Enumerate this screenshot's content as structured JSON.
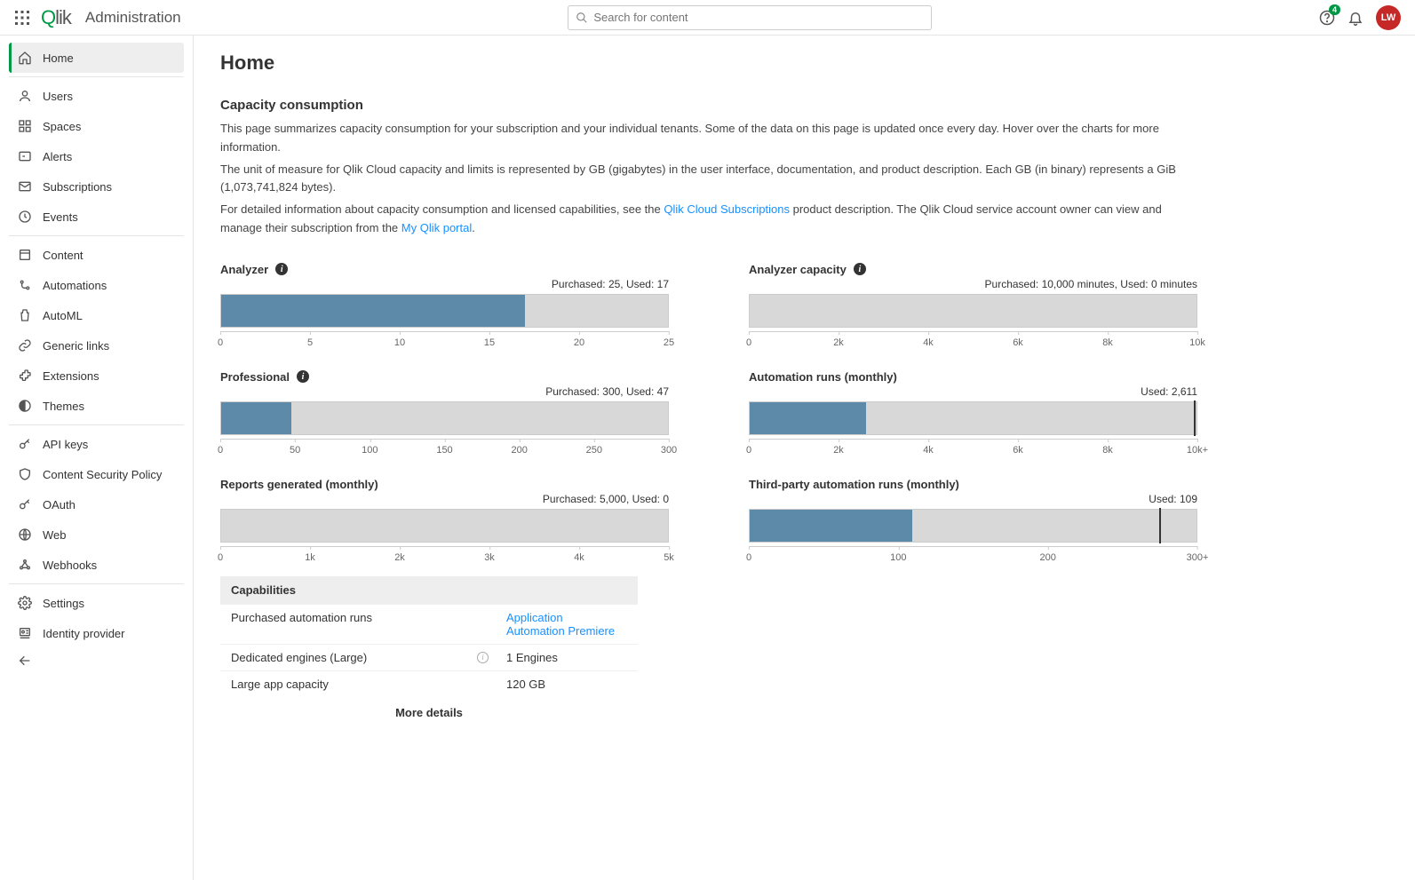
{
  "header": {
    "app_title": "Administration",
    "search_placeholder": "Search for content",
    "notification_badge": "4",
    "avatar_initials": "LW"
  },
  "sidebar": {
    "groups": [
      [
        "Home"
      ],
      [
        "Users",
        "Spaces",
        "Alerts",
        "Subscriptions",
        "Events"
      ],
      [
        "Content",
        "Automations",
        "AutoML",
        "Generic links",
        "Extensions",
        "Themes"
      ],
      [
        "API keys",
        "Content Security Policy",
        "OAuth",
        "Web",
        "Webhooks"
      ],
      [
        "Settings",
        "Identity provider"
      ]
    ],
    "active": "Home"
  },
  "page": {
    "title": "Home",
    "section_title": "Capacity consumption",
    "desc1": "This page summarizes capacity consumption for your subscription and your individual tenants. Some of the data on this page is updated once every day. Hover over the charts for more information.",
    "desc2": "The unit of measure for Qlik Cloud capacity and limits is represented by GB (gigabytes) in the user interface, documentation, and product description. Each GB (in binary) represents a GiB (1,073,741,824 bytes).",
    "desc3a": "For detailed information about capacity consumption and licensed capabilities, see the ",
    "desc3_link1": "Qlik Cloud Subscriptions",
    "desc3b": " product description. The Qlik Cloud service account owner can view and manage their subscription from the ",
    "desc3_link2": "My Qlik portal",
    "desc3c": "."
  },
  "chart_data": [
    {
      "title": "Analyzer",
      "subtitle": "Purchased: 25, Used: 17",
      "used": 17,
      "max": 25,
      "ticks": [
        "0",
        "5",
        "10",
        "15",
        "20",
        "25"
      ],
      "info_icon": true
    },
    {
      "title": "Analyzer capacity",
      "subtitle": "Purchased: 10,000 minutes, Used: 0 minutes",
      "used": 0,
      "max": 10000,
      "ticks": [
        "0",
        "2k",
        "4k",
        "6k",
        "8k",
        "10k"
      ],
      "info_icon": true
    },
    {
      "title": "Professional",
      "subtitle": "Purchased: 300, Used: 47",
      "used": 47,
      "max": 300,
      "ticks": [
        "0",
        "50",
        "100",
        "150",
        "200",
        "250",
        "300"
      ],
      "info_icon": true
    },
    {
      "title": "Automation runs (monthly)",
      "subtitle": "Used: 2,611",
      "used": 2611,
      "max": 10000,
      "limit_at": 10000,
      "ticks": [
        "0",
        "2k",
        "4k",
        "6k",
        "8k",
        "10k+"
      ],
      "info_icon": false
    },
    {
      "title": "Reports generated (monthly)",
      "subtitle": "Purchased: 5,000, Used: 0",
      "used": 0,
      "max": 5000,
      "ticks": [
        "0",
        "1k",
        "2k",
        "3k",
        "4k",
        "5k"
      ],
      "info_icon": false
    },
    {
      "title": "Third-party automation runs (monthly)",
      "subtitle": "Used: 109",
      "used": 109,
      "max": 300,
      "limit_at": 275,
      "ticks": [
        "0",
        "100",
        "200",
        "300+"
      ],
      "info_icon": false
    }
  ],
  "capabilities": {
    "header": "Capabilities",
    "rows": [
      {
        "label": "Purchased automation runs",
        "value_links": [
          "Application",
          "Automation Premiere"
        ]
      },
      {
        "label": "Dedicated engines (Large)",
        "info": true,
        "value": "1 Engines"
      },
      {
        "label": "Large app capacity",
        "value": "120 GB"
      }
    ],
    "more": "More details"
  }
}
